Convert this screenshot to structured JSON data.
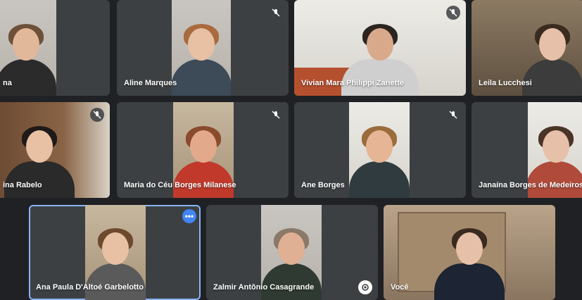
{
  "meeting": {
    "participants": [
      {
        "name": "na",
        "muted": false
      },
      {
        "name": "Aline Marques",
        "muted": true
      },
      {
        "name": "Vivian Mara Philippi Zanette",
        "muted": true
      },
      {
        "name": "Leila Lucchesi",
        "muted": false
      },
      {
        "name": "ina Rabelo",
        "muted": true
      },
      {
        "name": "Maria do Céu Borges Milanese",
        "muted": true
      },
      {
        "name": "Ane Borges",
        "muted": true
      },
      {
        "name": "Janaína Borges de Medeiros",
        "muted": false
      },
      {
        "name": "Ana Paula D'Altoé Garbelotto",
        "muted": false
      },
      {
        "name": "Zalmir Antônio Casagrande",
        "muted": false
      },
      {
        "name": "Você",
        "muted": false
      }
    ],
    "more_options": "•••"
  },
  "colors": {
    "background": "#202124",
    "tile": "#3c4043",
    "active_outline": "#8ab4f8",
    "more_button": "#4285f4"
  }
}
